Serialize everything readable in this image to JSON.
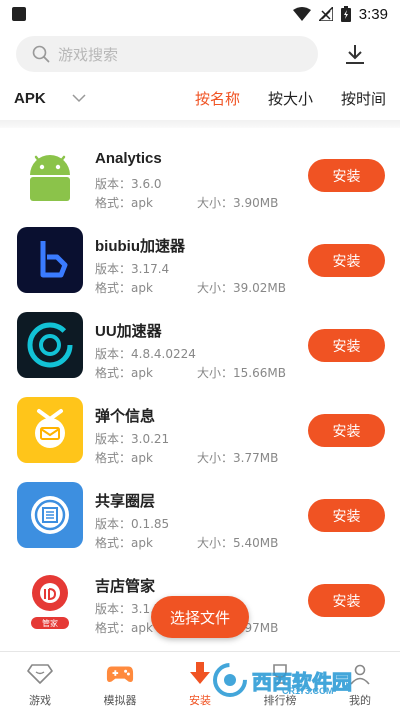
{
  "status_bar": {
    "time": "3:39"
  },
  "search": {
    "placeholder": "游戏搜索"
  },
  "filter": {
    "type_label": "APK",
    "sorts": [
      {
        "label": "按名称",
        "active": true
      },
      {
        "label": "按大小",
        "active": false
      },
      {
        "label": "按时间",
        "active": false
      }
    ]
  },
  "apps": [
    {
      "name": "Analytics",
      "version": "版本：3.6.0",
      "format": "格式：apk",
      "size": "大小：3.90MB",
      "install_label": "安装",
      "icon": "android-icon"
    },
    {
      "name": "biubiu加速器",
      "version": "版本：3.17.4",
      "format": "格式：apk",
      "size": "大小：39.02MB",
      "install_label": "安装",
      "icon": "biubiu-logo-icon"
    },
    {
      "name": "UU加速器",
      "version": "版本：4.8.4.0224",
      "format": "格式：apk",
      "size": "大小：15.66MB",
      "install_label": "安装",
      "icon": "uu-logo-icon"
    },
    {
      "name": "弹个信息",
      "version": "版本：3.0.21",
      "format": "格式：apk",
      "size": "大小：3.77MB",
      "install_label": "安装",
      "icon": "message-logo-icon"
    },
    {
      "name": "共享圈层",
      "version": "版本：0.1.85",
      "format": "格式：apk",
      "size": "大小：5.40MB",
      "install_label": "安装",
      "icon": "circle-logo-icon"
    },
    {
      "name": "吉店管家",
      "version": "版本：3.1.7",
      "format": "格式：apk",
      "size": "大小：...97MB",
      "install_label": "安装",
      "icon": "jidian-logo-icon",
      "icon_badge": "管家"
    }
  ],
  "fab": {
    "label": "选择文件"
  },
  "tabs": [
    {
      "label": "游戏",
      "icon": "diamond-icon",
      "active": false
    },
    {
      "label": "模拟器",
      "icon": "gamepad-icon",
      "active": false
    },
    {
      "label": "安装",
      "icon": "download-arrow-icon",
      "active": true
    },
    {
      "label": "排行榜",
      "icon": "trophy-icon",
      "active": false
    },
    {
      "label": "我的",
      "icon": "user-icon",
      "active": false
    }
  ],
  "watermark": {
    "text": "西西软件园",
    "sub": "CR173.COM"
  },
  "colors": {
    "accent": "#f05323",
    "text": "#222222",
    "muted": "#888888"
  }
}
